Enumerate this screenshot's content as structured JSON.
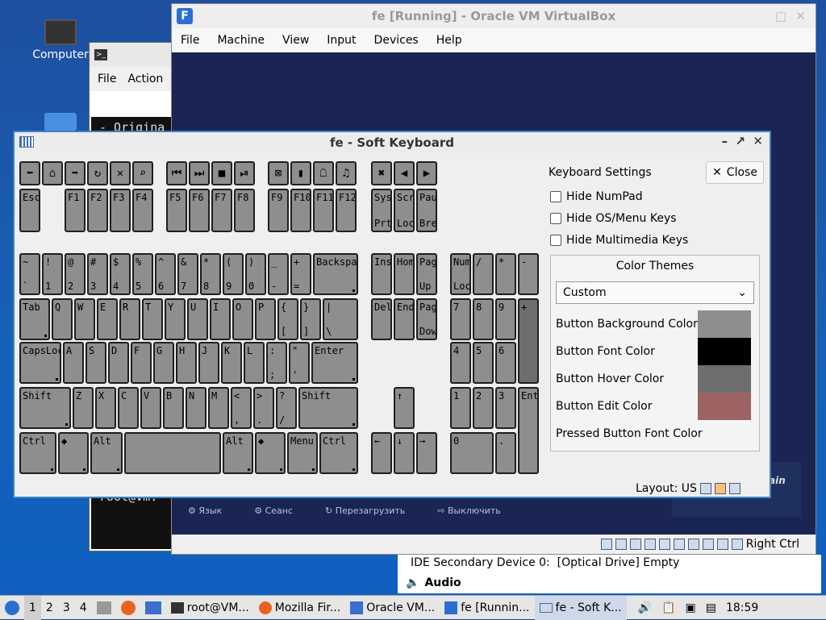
{
  "desktop": {
    "computer_label": "Computer"
  },
  "terminal": {
    "menu": [
      "File",
      "Action"
    ],
    "text_line": "- Origina",
    "prompt": "root@vm:"
  },
  "vbox": {
    "title": "fe [Running] - Oracle VM VirtualBox",
    "menu": [
      "File",
      "Machine",
      "View",
      "Input",
      "Devices",
      "Help"
    ],
    "vm_items": [
      "Язык",
      "Сеанс",
      "Перезагрузить",
      "Выключить"
    ],
    "vm_brand_fragment": "ain",
    "status_hostkey": "Right Ctrl"
  },
  "details": {
    "ide": "IDE Secondary Device 0:",
    "ide_val": "[Optical Drive] Empty",
    "audio": "Audio"
  },
  "keyboard": {
    "title": "fe - Soft Keyboard",
    "settings_label": "Keyboard Settings",
    "close_label": "Close",
    "options": [
      "Hide NumPad",
      "Hide OS/Menu Keys",
      "Hide Multimedia Keys"
    ],
    "themes_label": "Color Themes",
    "theme_selected": "Custom",
    "colors": [
      {
        "label": "Button Background Color",
        "color": "#8e8e8e"
      },
      {
        "label": "Button Font Color",
        "color": "#000000"
      },
      {
        "label": "Button Hover Color",
        "color": "#6e6e6e"
      },
      {
        "label": "Button Edit Color",
        "color": "#9d6262"
      },
      {
        "label": "Pressed Button Font Color",
        "color": ""
      }
    ],
    "layout": "Layout: US",
    "fkeys": [
      "Esc",
      "F1",
      "F2",
      "F3",
      "F4",
      "F5",
      "F6",
      "F7",
      "F8",
      "F9",
      "F10",
      "F11",
      "F12"
    ],
    "sysrq": [
      "SysRq",
      "PrtScr"
    ],
    "scroll": [
      "Scroll",
      "Lock"
    ],
    "pause": [
      "Pause",
      "Break"
    ],
    "row1": [
      [
        "~",
        "`"
      ],
      [
        "!",
        "1"
      ],
      [
        "@",
        "2"
      ],
      [
        "#",
        "3"
      ],
      [
        "$",
        "4"
      ],
      [
        "%",
        "5"
      ],
      [
        "^",
        "6"
      ],
      [
        "&",
        "7"
      ],
      [
        "*",
        "8"
      ],
      [
        "(",
        "9"
      ],
      [
        ")",
        "0"
      ],
      [
        "_",
        "-"
      ],
      [
        "+",
        "="
      ]
    ],
    "backspace": "Backspace",
    "row2": [
      "Q",
      "W",
      "E",
      "R",
      "T",
      "Y",
      "U",
      "I",
      "O",
      "P"
    ],
    "row2b": [
      [
        "{",
        "["
      ],
      [
        "}",
        "]"
      ],
      [
        "|",
        "\\"
      ]
    ],
    "tab": "Tab",
    "row3": [
      "A",
      "S",
      "D",
      "F",
      "G",
      "H",
      "J",
      "K",
      "L"
    ],
    "row3b": [
      [
        ":",
        ";"
      ],
      [
        "\"",
        "'"
      ]
    ],
    "caps": "CapsLock",
    "enter": "Enter",
    "row4": [
      "Z",
      "X",
      "C",
      "V",
      "B",
      "N",
      "M"
    ],
    "row4b": [
      [
        "<",
        ","
      ],
      [
        ">",
        "."
      ],
      [
        "?",
        "/"
      ]
    ],
    "shift": "Shift",
    "ctrl": "Ctrl",
    "alt": "Alt",
    "menu": "Menu",
    "nav": [
      "Insert",
      "Home",
      "Page Up",
      "Delete",
      "End",
      "Page Down"
    ],
    "numpad": [
      "Num Lock",
      "/",
      "*",
      "-",
      "7",
      "8",
      "9",
      "+",
      "4",
      "5",
      "6",
      "1",
      "2",
      "3",
      "Enter",
      "0",
      "."
    ]
  },
  "taskbar": {
    "workspaces": [
      "1",
      "2",
      "3",
      "4"
    ],
    "tasks": [
      "root@VM...",
      "Mozilla Fir...",
      "Oracle VM...",
      "fe [Runnin...",
      "fe - Soft K..."
    ],
    "clock": "18:59"
  }
}
